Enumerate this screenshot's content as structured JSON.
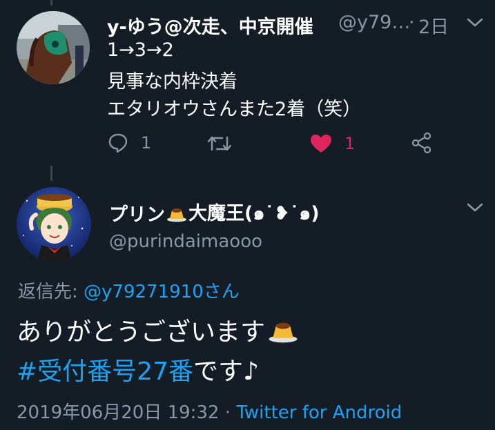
{
  "tweet1": {
    "display_name": "y-ゆう@次走、中京開催",
    "handle": "@y79…",
    "separator": "·",
    "time": "2日",
    "lines": [
      "1→3→2",
      "見事な内枠決着",
      "エタリオウさんまた2着（笑）"
    ],
    "reply_count": "1",
    "like_count": "1",
    "liked_color": "#e0245e"
  },
  "tweet2": {
    "display_name_before": "プリン",
    "display_name_after": "大魔王(๑˙❥˙๑)",
    "handle": "@purindaimaooo",
    "reply_prefix": "返信先: ",
    "reply_mention": "@y79271910さん",
    "body_line1": "ありがとうございます",
    "hashtag": "#受付番号27番",
    "body_line2_rest": " です♪",
    "timestamp": "2019年06月20日 19:32",
    "meta_separator": " · ",
    "source": "Twitter for Android"
  },
  "colors": {
    "background": "#141d26",
    "primary_text": "#ffffff",
    "secondary_text": "#8899a6",
    "link": "#1da1f2",
    "like": "#e0245e",
    "thread_line": "#38444d"
  },
  "icons": [
    "reply-icon",
    "retweet-icon",
    "heart-icon",
    "share-icon",
    "chevron-down-icon",
    "pudding-emoji"
  ]
}
